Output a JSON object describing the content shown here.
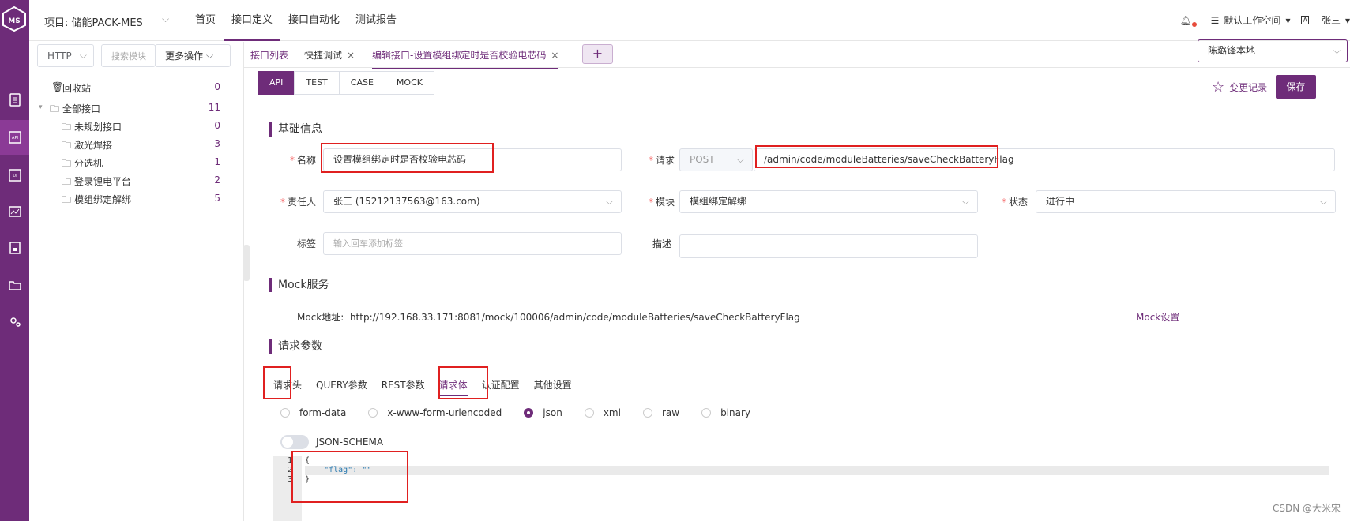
{
  "topbar": {
    "project": "项目: 储能PACK-MES",
    "nav": [
      "首页",
      "接口定义",
      "接口自动化",
      "测试报告"
    ],
    "workspace": "默认工作空间",
    "user": "张三"
  },
  "sidebar": {
    "protocol": "HTTP",
    "search_placeholder": "搜索模块",
    "more_ops": "更多操作",
    "tree": [
      {
        "label": "回收站",
        "count": "0"
      },
      {
        "label": "全部接口",
        "count": "11"
      },
      {
        "label": "未规划接口",
        "count": "0"
      },
      {
        "label": "激光焊接",
        "count": "3"
      },
      {
        "label": "分选机",
        "count": "1"
      },
      {
        "label": "登录锂电平台",
        "count": "2"
      },
      {
        "label": "模组绑定解绑",
        "count": "5"
      }
    ]
  },
  "tabs": {
    "list": "接口列表",
    "debug": "快捷调试",
    "edit": "编辑接口-设置模组绑定时是否校验电芯码",
    "env": "陈璐锋本地"
  },
  "modes": [
    "API",
    "TEST",
    "CASE",
    "MOCK"
  ],
  "actions": {
    "changes": "变更记录",
    "save": "保存"
  },
  "basic": {
    "title": "基础信息",
    "name_label": "名称",
    "name_value": "设置模组绑定时是否校验电芯码",
    "request_label": "请求",
    "method": "POST",
    "path": "/admin/code/moduleBatteries/saveCheckBatteryFlag",
    "owner_label": "责任人",
    "owner_value": "张三 (15212137563@163.com)",
    "module_label": "模块",
    "module_value": "模组绑定解绑",
    "status_label": "状态",
    "status_value": "进行中",
    "tag_label": "标签",
    "tag_placeholder": "输入回车添加标签",
    "desc_label": "描述"
  },
  "mock": {
    "title": "Mock服务",
    "addr_label": "Mock地址:",
    "addr": "http://192.168.33.171:8081/mock/100006/admin/code/moduleBatteries/saveCheckBatteryFlag",
    "settings": "Mock设置"
  },
  "params": {
    "title": "请求参数",
    "tabs": [
      "请求头",
      "QUERY参数",
      "REST参数",
      "请求体",
      "认证配置",
      "其他设置"
    ],
    "body_types": [
      "form-data",
      "x-www-form-urlencoded",
      "json",
      "xml",
      "raw",
      "binary"
    ],
    "selected_body_type": "json",
    "schema_label": "JSON-SCHEMA",
    "line_numbers": [
      "1",
      "2",
      "3"
    ],
    "code": [
      "{",
      "    \"flag\": \"\"",
      "}"
    ]
  },
  "watermark": "CSDN @大米宋",
  "colors": {
    "brand": "#6e2c79",
    "highlight_box": "#e02020"
  }
}
